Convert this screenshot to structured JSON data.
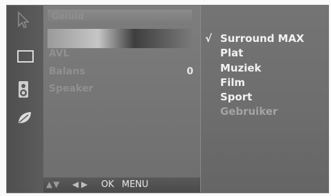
{
  "menu": {
    "title": "Geluid",
    "items": [
      {
        "label": "AVL",
        "value": ""
      },
      {
        "label": "Balans",
        "value": "0"
      },
      {
        "label": "Speaker",
        "value": ""
      }
    ]
  },
  "navbar": {
    "updown": "▲▼",
    "leftright": "◀ ▶",
    "ok_label": "OK",
    "menu_label": "MENU"
  },
  "submenu": {
    "check_mark": "√",
    "options": [
      {
        "label": "Surround MAX",
        "checked": true,
        "enabled": true
      },
      {
        "label": "Plat",
        "checked": false,
        "enabled": true
      },
      {
        "label": "Muziek",
        "checked": false,
        "enabled": true
      },
      {
        "label": "Film",
        "checked": false,
        "enabled": true
      },
      {
        "label": "Sport",
        "checked": false,
        "enabled": true
      },
      {
        "label": "Gebruiker",
        "checked": false,
        "enabled": false
      }
    ]
  },
  "icons": [
    "pointer-icon",
    "screen-icon",
    "speaker-icon",
    "leaf-icon"
  ]
}
